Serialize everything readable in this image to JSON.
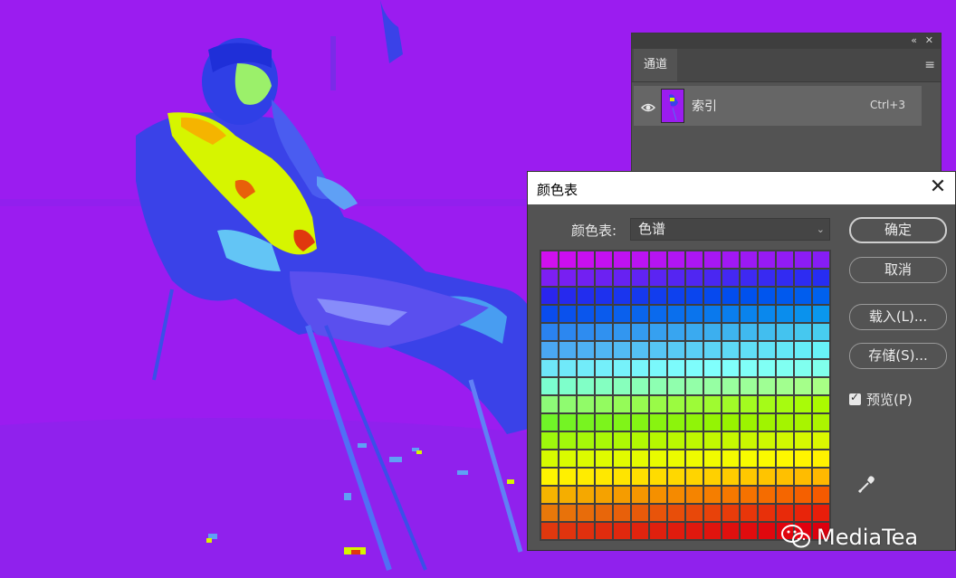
{
  "channels_panel": {
    "tab": "通道",
    "channel": {
      "name": "索引",
      "shortcut": "Ctrl+3"
    },
    "collapse_icon": "double-chevron-left-icon",
    "close_icon": "close-icon",
    "menu_icon": "hamburger-menu-icon"
  },
  "color_table_dialog": {
    "title": "颜色表",
    "table_label": "颜色表:",
    "table_value": "色谱",
    "buttons": {
      "ok": "确定",
      "cancel": "取消",
      "load": "载入(L)...",
      "save": "存储(S)..."
    },
    "preview_label": "预览(P)",
    "preview_checked": true,
    "swatch_rows": [
      [
        "#d010ef",
        "#cc0ef0",
        "#c80ff0",
        "#c410f1",
        "#bf12f1",
        "#bb13f2",
        "#b614f2",
        "#b115f3",
        "#ac16f3",
        "#a717f3",
        "#a218f4",
        "#9c19f4",
        "#971af4",
        "#921bf5",
        "#8c1cf5",
        "#861df5"
      ],
      [
        "#7d1ff2",
        "#781ff2",
        "#7220f2",
        "#6c21f2",
        "#6722f2",
        "#6123f2",
        "#5b24f2",
        "#5525f2",
        "#5026f2",
        "#4a27f2",
        "#4428f2",
        "#3e29f2",
        "#382af2",
        "#322bf2",
        "#2d2cf2",
        "#272df2"
      ],
      [
        "#2a25ee",
        "#2629ee",
        "#222dee",
        "#1e31ee",
        "#1a35ee",
        "#1639ee",
        "#123dee",
        "#0e41ee",
        "#0a45ee",
        "#0649ee",
        "#024dee",
        "#0051ee",
        "#0055ee",
        "#0059ee",
        "#005dee",
        "#0061ee"
      ],
      [
        "#0a4ced",
        "#0a51ed",
        "#0a56ed",
        "#0a5bed",
        "#0a60ed",
        "#0a65ed",
        "#0a6aed",
        "#0a6fed",
        "#0a74ed",
        "#0a79ed",
        "#0a7eed",
        "#0a83ed",
        "#0a88ed",
        "#0a8ded",
        "#0a92ed",
        "#0a97ed"
      ],
      [
        "#2a82f0",
        "#2c87f0",
        "#2e8cf0",
        "#3091f0",
        "#3296f0",
        "#349bf0",
        "#36a0f0",
        "#38a5f0",
        "#3aaaf0",
        "#3cafef",
        "#3eb4ef",
        "#40b9ef",
        "#42beef",
        "#44c3ef",
        "#46c8ef",
        "#48cdef"
      ],
      [
        "#4aa7f2",
        "#4cacf2",
        "#4eb1f3",
        "#50b6f3",
        "#52bbf3",
        "#54c0f4",
        "#56c5f4",
        "#58caf4",
        "#5acff5",
        "#5cd4f5",
        "#5ed9f5",
        "#60def6",
        "#62e3f6",
        "#64e8f6",
        "#66edf7",
        "#68f2f7"
      ],
      [
        "#6ee6f8",
        "#70e9f9",
        "#72ecf9",
        "#74effa",
        "#76f2fa",
        "#78f5fb",
        "#7af8fb",
        "#7cfbfc",
        "#7efdfc",
        "#80fffd",
        "#80fffb",
        "#80fff8",
        "#80fff5",
        "#80fff2",
        "#80ffef",
        "#80ffec"
      ],
      [
        "#7bffd0",
        "#7effcb",
        "#81ffc6",
        "#84ffc1",
        "#87ffbc",
        "#8affb7",
        "#8dffb2",
        "#90ffad",
        "#93ffa8",
        "#96ffa3",
        "#99ff9e",
        "#9cff99",
        "#9fff94",
        "#a2ff8f",
        "#a5ff8a",
        "#a8ff85"
      ],
      [
        "#8dfb78",
        "#8ffb70",
        "#91fb68",
        "#93fb60",
        "#95fb58",
        "#97fb50",
        "#99fb48",
        "#9bfb40",
        "#9dfb38",
        "#9ffb30",
        "#a1fb28",
        "#a3fb20",
        "#a5fb18",
        "#a7fb10",
        "#a9fb08",
        "#abfb00"
      ],
      [
        "#70f428",
        "#74f424",
        "#78f420",
        "#7cf41c",
        "#80f418",
        "#84f414",
        "#88f410",
        "#8cf40c",
        "#90f408",
        "#94f404",
        "#98f400",
        "#9cf400",
        "#a0f400",
        "#a4f400",
        "#a8f400",
        "#acf400"
      ],
      [
        "#9ef80c",
        "#a2f80a",
        "#a6f808",
        "#aaf806",
        "#aef804",
        "#b2f802",
        "#b6f800",
        "#baf800",
        "#bef800",
        "#c2f800",
        "#c6f800",
        "#caf800",
        "#cef800",
        "#d2f800",
        "#d6f800",
        "#daf800"
      ],
      [
        "#d6fb00",
        "#d9fb00",
        "#dcfb00",
        "#dffb00",
        "#e2fb00",
        "#e5fb00",
        "#e8fb00",
        "#ebfb00",
        "#eefb00",
        "#f1fb00",
        "#f4fb00",
        "#f7fb00",
        "#fafa00",
        "#fdf800",
        "#fff500",
        "#fff200"
      ],
      [
        "#fff400",
        "#fff000",
        "#ffec00",
        "#ffe800",
        "#ffe400",
        "#ffe000",
        "#ffdc00",
        "#ffd800",
        "#ffd400",
        "#ffd000",
        "#ffcc00",
        "#ffc800",
        "#ffc400",
        "#ffc000",
        "#ffbc00",
        "#ffb800"
      ],
      [
        "#f5b400",
        "#f5ae00",
        "#f5a800",
        "#f5a200",
        "#f59c00",
        "#f59600",
        "#f59000",
        "#f58a00",
        "#f58400",
        "#f57e00",
        "#f57800",
        "#f57200",
        "#f56c00",
        "#f56600",
        "#f56000",
        "#f55a00"
      ],
      [
        "#e8780a",
        "#e8720a",
        "#e86c0a",
        "#e8660a",
        "#e8600a",
        "#e85a0a",
        "#e8540a",
        "#e84e0a",
        "#e8480a",
        "#e8420a",
        "#e83c0a",
        "#e8360a",
        "#e8300a",
        "#e82a0a",
        "#e8240a",
        "#e81e0a"
      ],
      [
        "#e0380e",
        "#e0340e",
        "#e0300e",
        "#e02c0e",
        "#e0280e",
        "#e0240e",
        "#e0200e",
        "#e01c0e",
        "#e0180e",
        "#e0140e",
        "#e0100e",
        "#e00c0e",
        "#e0080e",
        "#e0040e",
        "#e0000e",
        "#dc000e"
      ]
    ],
    "eyedropper_icon": "eyedropper-icon"
  },
  "watermark": {
    "text": "MediaTea",
    "icon": "wechat-icon"
  }
}
